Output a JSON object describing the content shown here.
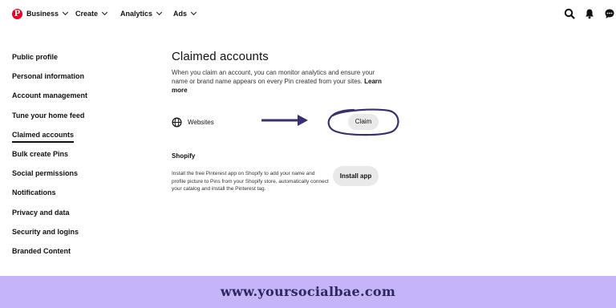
{
  "nav": {
    "logo_letter": "P",
    "items": [
      {
        "label": "Business"
      },
      {
        "label": "Create"
      },
      {
        "label": "Analytics"
      },
      {
        "label": "Ads"
      }
    ],
    "icons": [
      "search-icon",
      "bell-icon",
      "chat-icon"
    ],
    "brand_color": "#e60023"
  },
  "sidebar": {
    "items": [
      {
        "label": "Public profile"
      },
      {
        "label": "Personal information"
      },
      {
        "label": "Account management"
      },
      {
        "label": "Tune your home feed"
      },
      {
        "label": "Claimed accounts",
        "active": true
      },
      {
        "label": "Bulk create Pins"
      },
      {
        "label": "Social permissions"
      },
      {
        "label": "Notifications"
      },
      {
        "label": "Privacy and data"
      },
      {
        "label": "Security and logins"
      },
      {
        "label": "Branded Content"
      }
    ]
  },
  "main": {
    "title": "Claimed accounts",
    "description": "When you claim an account, you can monitor analytics and ensure your name or brand name appears on every Pin created from your sites.",
    "learn_more": "Learn more",
    "websites": {
      "label": "Websites",
      "button": "Claim"
    },
    "shopify": {
      "title": "Shopify",
      "description": "Install the free Pinterest app on Shopify to add your name and profile picture to Pins from your Shopify store, automatically connect your catalog and install the Pinterest tag.",
      "button": "Install app"
    },
    "annotation_color": "#3b2f6e"
  },
  "footer": {
    "text": "www.yoursocialbae.com",
    "background": "#c5b4f7"
  }
}
